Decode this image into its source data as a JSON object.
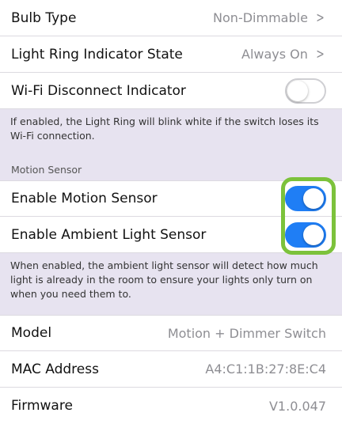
{
  "settings": {
    "bulb_type": {
      "label": "Bulb Type",
      "value": "Non-Dimmable"
    },
    "light_ring": {
      "label": "Light Ring Indicator State",
      "value": "Always On"
    },
    "wifi_disconnect": {
      "label": "Wi-Fi Disconnect Indicator",
      "enabled": false
    },
    "wifi_note": "If enabled, the Light Ring will blink white if the switch loses its Wi-Fi connection."
  },
  "motion_section": {
    "header": "Motion Sensor",
    "enable_motion": {
      "label": "Enable Motion Sensor",
      "enabled": true
    },
    "enable_ambient": {
      "label": "Enable Ambient Light Sensor",
      "enabled": true
    },
    "ambient_note": "When enabled, the ambient light sensor will detect how much light is already in the room to ensure your lights only turn on when you need them to."
  },
  "info": {
    "model": {
      "label": "Model",
      "value": "Motion + Dimmer Switch"
    },
    "mac": {
      "label": "MAC Address",
      "value": "A4:C1:1B:27:8E:C4"
    },
    "firmware": {
      "label": "Firmware",
      "value": "V1.0.047"
    }
  },
  "icons": {
    "chevron": "chevron-right-icon"
  },
  "colors": {
    "toggle_on": "#1f7ef5",
    "highlight": "#7cc23b",
    "background": "#e7e3f0"
  }
}
